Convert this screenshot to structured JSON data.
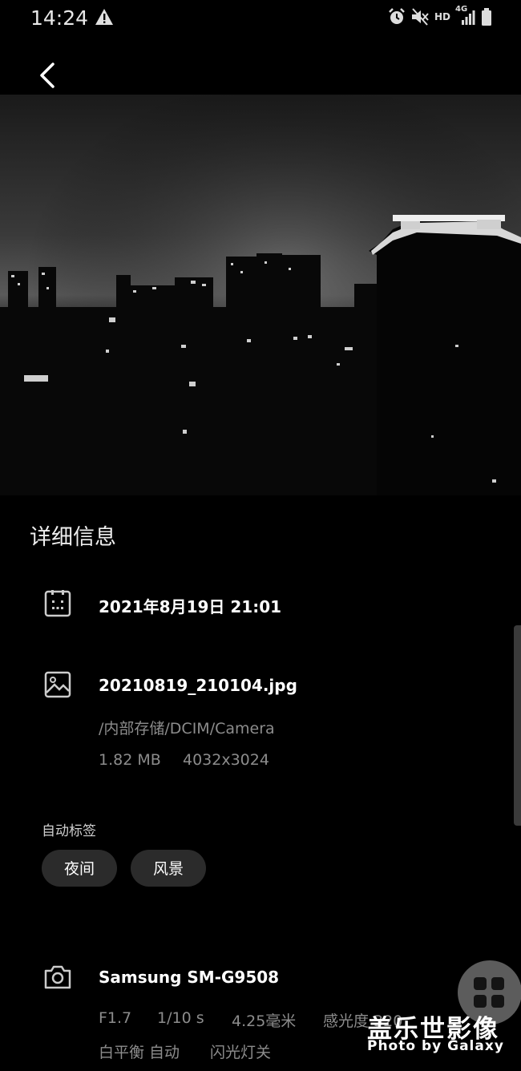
{
  "status_bar": {
    "time": "14:24",
    "icons": [
      "warning-icon",
      "alarm-icon",
      "mute-icon",
      "hd-icon",
      "signal-4g-icon",
      "battery-icon"
    ],
    "hd_label": "HD",
    "network_label": "4G"
  },
  "header": {
    "back_icon": "chevron-left-icon"
  },
  "details": {
    "section_title": "详细信息",
    "date": "2021年8月19日 21:01",
    "filename": "20210819_210104.jpg",
    "path": "/内部存储/DCIM/Camera",
    "size": "1.82 MB",
    "resolution": "4032x3024",
    "tags_label": "自动标签",
    "tags": [
      "夜间",
      "风景"
    ],
    "device": "Samsung SM-G9508",
    "aperture": "F1.7",
    "shutter": "1/10 s",
    "focal_length": "4.25毫米",
    "iso": "感光度 320",
    "white_balance": "白平衡 自动",
    "flash": "闪光灯关"
  },
  "fab": {
    "icon": "grid-apps-icon"
  },
  "watermark": {
    "title": "盖乐世影像",
    "subtitle": "Photo by Galaxy"
  }
}
